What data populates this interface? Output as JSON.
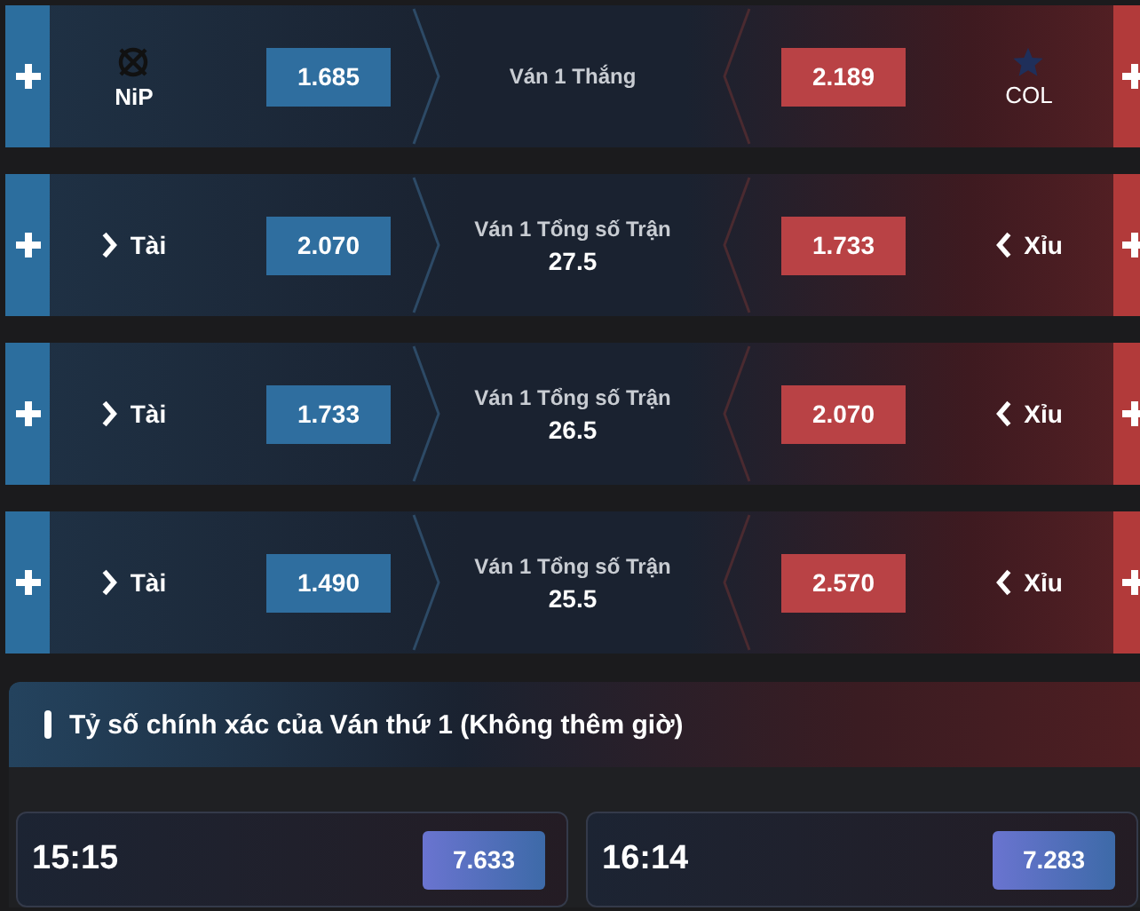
{
  "markets": [
    {
      "kind": "team",
      "left_label": "NiP",
      "left_odds": "1.685",
      "title": "Ván 1 Thắng",
      "right_odds": "2.189",
      "right_label": "COL"
    },
    {
      "kind": "total",
      "left_label": "Tài",
      "left_odds": "2.070",
      "title": "Ván 1 Tổng số Trận",
      "line": "27.5",
      "right_odds": "1.733",
      "right_label": "Xỉu"
    },
    {
      "kind": "total",
      "left_label": "Tài",
      "left_odds": "1.733",
      "title": "Ván 1 Tổng số Trận",
      "line": "26.5",
      "right_odds": "2.070",
      "right_label": "Xỉu"
    },
    {
      "kind": "total",
      "left_label": "Tài",
      "left_odds": "1.490",
      "title": "Ván 1 Tổng số Trận",
      "line": "25.5",
      "right_odds": "2.570",
      "right_label": "Xỉu"
    }
  ],
  "exact_score": {
    "title": "Tỷ số chính xác của Ván thứ 1 (Không thêm giờ)",
    "scores": [
      {
        "score": "15:15",
        "odds": "7.633"
      },
      {
        "score": "16:14",
        "odds": "7.283"
      }
    ]
  }
}
